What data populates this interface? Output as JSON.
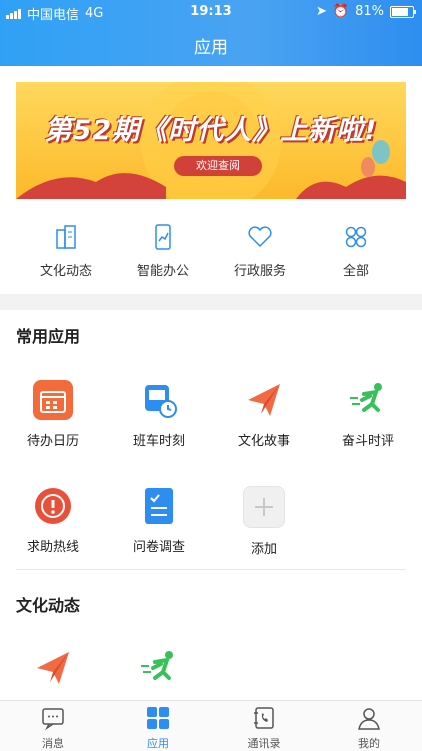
{
  "status": {
    "carrier": "中国电信",
    "network": "4G",
    "time": "19:13",
    "battery": "81%"
  },
  "header": {
    "title": "应用"
  },
  "banner": {
    "headline": "第52期《时代人》上新啦!",
    "button": "欢迎查阅"
  },
  "quick": [
    {
      "label": "文化动态",
      "icon": "building-icon"
    },
    {
      "label": "智能办公",
      "icon": "phone-chart-icon"
    },
    {
      "label": "行政服务",
      "icon": "heart-icon"
    },
    {
      "label": "全部",
      "icon": "grid-icon"
    }
  ],
  "sections": {
    "common": "常用应用",
    "culture": "文化动态"
  },
  "apps": [
    {
      "label": "待办日历",
      "icon": "calendar-icon",
      "color": "#f36b3a"
    },
    {
      "label": "班车时刻",
      "icon": "bus-icon",
      "color": "#2d8ef0"
    },
    {
      "label": "文化故事",
      "icon": "paper-plane-icon",
      "color": "#f26a44"
    },
    {
      "label": "奋斗时评",
      "icon": "runner-icon",
      "color": "#38c15a"
    },
    {
      "label": "求助热线",
      "icon": "alert-icon",
      "color": "#e9503a"
    },
    {
      "label": "问卷调查",
      "icon": "checklist-icon",
      "color": "#2d8ef0"
    },
    {
      "label": "添加",
      "icon": "plus-icon",
      "color": "#c8c8c8"
    }
  ],
  "tabs": [
    {
      "label": "消息",
      "icon": "message-icon"
    },
    {
      "label": "应用",
      "icon": "apps-icon"
    },
    {
      "label": "通讯录",
      "icon": "contacts-icon"
    },
    {
      "label": "我的",
      "icon": "profile-icon"
    }
  ],
  "colors": {
    "primary": "#2d8ef0",
    "header_start": "#2fa1f5"
  }
}
